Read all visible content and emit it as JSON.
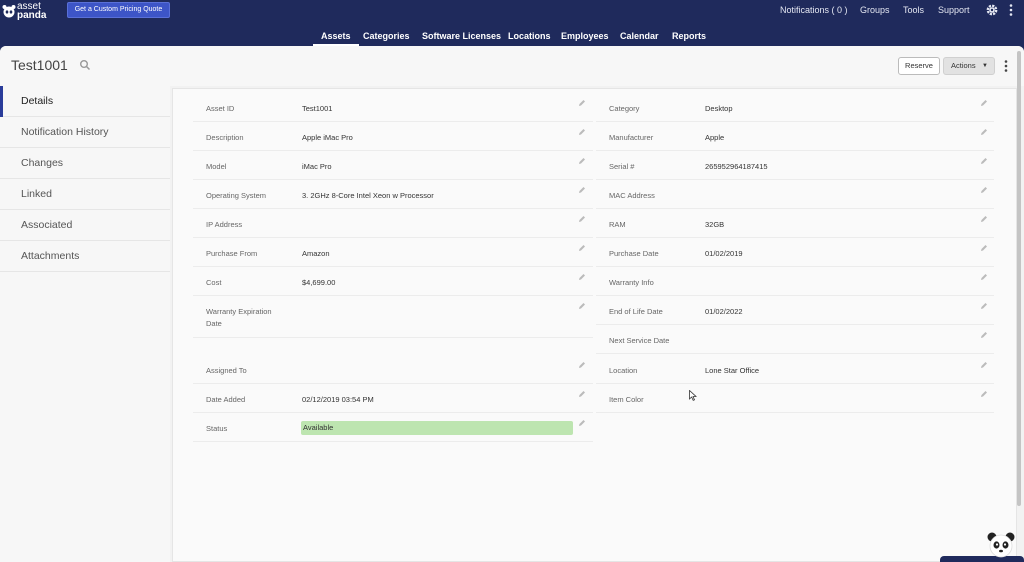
{
  "brand": {
    "line1": "asset",
    "line2": "panda"
  },
  "quote_button": "Get a Custom Pricing Quote",
  "top_links": {
    "notifications": "Notifications ( 0 )",
    "groups": "Groups",
    "tools": "Tools",
    "support": "Support"
  },
  "nav": [
    "Assets",
    "Categories",
    "Software Licenses",
    "Locations",
    "Employees",
    "Calendar",
    "Reports"
  ],
  "page_title": "Test1001",
  "buttons": {
    "reserve": "Reserve",
    "actions": "Actions"
  },
  "sidebar": [
    "Details",
    "Notification History",
    "Changes",
    "Linked",
    "Associated",
    "Attachments"
  ],
  "fields_left": [
    {
      "label": "Asset ID",
      "value": "Test1001"
    },
    {
      "label": "Description",
      "value": "Apple iMac Pro"
    },
    {
      "label": "Model",
      "value": "iMac Pro"
    },
    {
      "label": "Operating System",
      "value": "3. 2GHz 8-Core Intel Xeon w Processor"
    },
    {
      "label": "IP Address",
      "value": ""
    },
    {
      "label": "Purchase From",
      "value": "Amazon"
    },
    {
      "label": "Cost",
      "value": "$4,699.00"
    },
    {
      "label": "Warranty Expiration",
      "label2": "Date",
      "value": ""
    },
    {
      "label": "Assigned To",
      "value": ""
    },
    {
      "label": "Date Added",
      "value": "02/12/2019 03:54 PM"
    },
    {
      "label": "Status",
      "value": "Available"
    }
  ],
  "fields_right": [
    {
      "label": "Category",
      "value": "Desktop"
    },
    {
      "label": "Manufacturer",
      "value": "Apple"
    },
    {
      "label": "Serial #",
      "value": "265952964187415"
    },
    {
      "label": "MAC Address",
      "value": ""
    },
    {
      "label": "RAM",
      "value": "32GB"
    },
    {
      "label": "Purchase Date",
      "value": "01/02/2019"
    },
    {
      "label": "Warranty Info",
      "value": ""
    },
    {
      "label": "End of Life Date",
      "value": "01/02/2022"
    },
    {
      "label": "Next Service Date",
      "value": ""
    },
    {
      "label": "Location",
      "value": "Lone Star Office"
    },
    {
      "label": "Item Color",
      "value": ""
    }
  ],
  "colors": {
    "header": "#1f2a5c",
    "status_available": "#bde5b0",
    "active_accent": "#2a3c9a"
  }
}
